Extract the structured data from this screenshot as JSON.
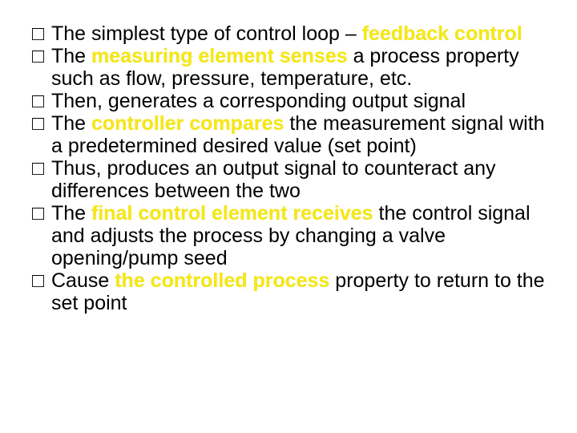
{
  "bullets": [
    {
      "pre": "The simplest type of control loop – ",
      "hl": "feedback control",
      "post": ""
    },
    {
      "pre": "The ",
      "hl": "measuring element senses",
      "post": " a process property such as flow, pressure, temperature, etc."
    },
    {
      "pre": "Then, generates a corresponding output signal",
      "hl": "",
      "post": ""
    },
    {
      "pre": "The ",
      "hl": "controller compares",
      "post": " the measurement signal with a predetermined desired value (set point)"
    },
    {
      "pre": "Thus, produces an output signal to counteract any differences between the two",
      "hl": "",
      "post": ""
    },
    {
      "pre": "The ",
      "hl": "final control element receives",
      "post": " the control signal and adjusts the process by changing a valve opening/pump seed"
    },
    {
      "pre": "Cause ",
      "hl": "the controlled process",
      "post": " property to return to the set point"
    }
  ],
  "marker": "□"
}
